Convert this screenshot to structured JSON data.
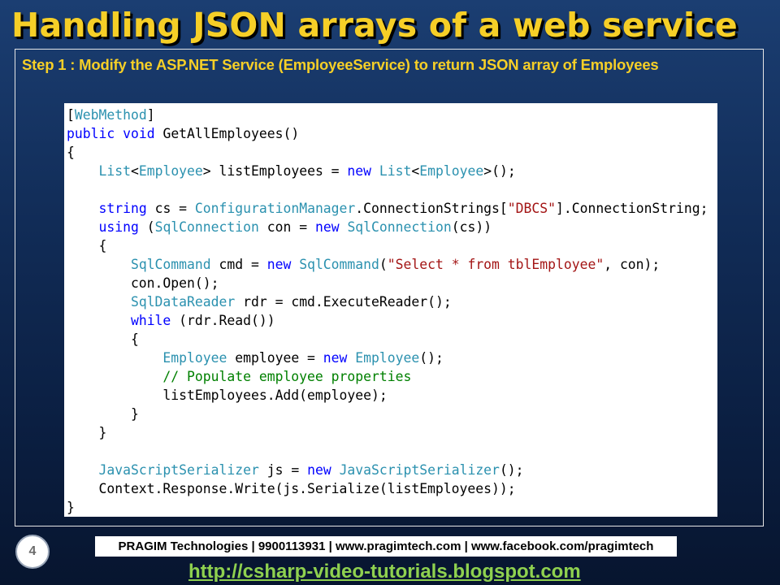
{
  "slide": {
    "title": "Handling JSON arrays of a web service",
    "step_text": "Step 1 : Modify the ASP.NET Service (EmployeeService) to return JSON array of Employees",
    "slide_number": "4",
    "footer_text": "PRAGIM Technologies | 9900113931 | www.pragimtech.com | www.facebook.com/pragimtech",
    "blog_link": "http://csharp-video-tutorials.blogspot.com"
  },
  "colors": {
    "title": "#f6cf27",
    "keyword": "#0000ff",
    "type": "#2b91af",
    "string": "#a31515",
    "comment": "#008000",
    "link": "#8fd14f"
  },
  "code": {
    "language": "csharp",
    "lines": [
      [
        [
          "plain",
          "["
        ],
        [
          "type",
          "WebMethod"
        ],
        [
          "plain",
          "]"
        ]
      ],
      [
        [
          "kw",
          "public"
        ],
        [
          "plain",
          " "
        ],
        [
          "kw",
          "void"
        ],
        [
          "plain",
          " GetAllEmployees()"
        ]
      ],
      [
        [
          "plain",
          "{"
        ]
      ],
      [
        [
          "plain",
          "    "
        ],
        [
          "type",
          "List"
        ],
        [
          "plain",
          "<"
        ],
        [
          "type",
          "Employee"
        ],
        [
          "plain",
          "> listEmployees = "
        ],
        [
          "kw",
          "new"
        ],
        [
          "plain",
          " "
        ],
        [
          "type",
          "List"
        ],
        [
          "plain",
          "<"
        ],
        [
          "type",
          "Employee"
        ],
        [
          "plain",
          ">();"
        ]
      ],
      [],
      [
        [
          "plain",
          "    "
        ],
        [
          "kw",
          "string"
        ],
        [
          "plain",
          " cs = "
        ],
        [
          "type",
          "ConfigurationManager"
        ],
        [
          "plain",
          ".ConnectionStrings["
        ],
        [
          "str",
          "\"DBCS\""
        ],
        [
          "plain",
          "].ConnectionString;"
        ]
      ],
      [
        [
          "plain",
          "    "
        ],
        [
          "kw",
          "using"
        ],
        [
          "plain",
          " ("
        ],
        [
          "type",
          "SqlConnection"
        ],
        [
          "plain",
          " con = "
        ],
        [
          "kw",
          "new"
        ],
        [
          "plain",
          " "
        ],
        [
          "type",
          "SqlConnection"
        ],
        [
          "plain",
          "(cs))"
        ]
      ],
      [
        [
          "plain",
          "    {"
        ]
      ],
      [
        [
          "plain",
          "        "
        ],
        [
          "type",
          "SqlCommand"
        ],
        [
          "plain",
          " cmd = "
        ],
        [
          "kw",
          "new"
        ],
        [
          "plain",
          " "
        ],
        [
          "type",
          "SqlCommand"
        ],
        [
          "plain",
          "("
        ],
        [
          "str",
          "\"Select * from tblEmployee\""
        ],
        [
          "plain",
          ", con);"
        ]
      ],
      [
        [
          "plain",
          "        con.Open();"
        ]
      ],
      [
        [
          "plain",
          "        "
        ],
        [
          "type",
          "SqlDataReader"
        ],
        [
          "plain",
          " rdr = cmd.ExecuteReader();"
        ]
      ],
      [
        [
          "plain",
          "        "
        ],
        [
          "kw",
          "while"
        ],
        [
          "plain",
          " (rdr.Read())"
        ]
      ],
      [
        [
          "plain",
          "        {"
        ]
      ],
      [
        [
          "plain",
          "            "
        ],
        [
          "type",
          "Employee"
        ],
        [
          "plain",
          " employee = "
        ],
        [
          "kw",
          "new"
        ],
        [
          "plain",
          " "
        ],
        [
          "type",
          "Employee"
        ],
        [
          "plain",
          "();"
        ]
      ],
      [
        [
          "plain",
          "            "
        ],
        [
          "cmt",
          "// Populate employee properties"
        ]
      ],
      [
        [
          "plain",
          "            listEmployees.Add(employee);"
        ]
      ],
      [
        [
          "plain",
          "        }"
        ]
      ],
      [
        [
          "plain",
          "    }"
        ]
      ],
      [],
      [
        [
          "plain",
          "    "
        ],
        [
          "type",
          "JavaScriptSerializer"
        ],
        [
          "plain",
          " js = "
        ],
        [
          "kw",
          "new"
        ],
        [
          "plain",
          " "
        ],
        [
          "type",
          "JavaScriptSerializer"
        ],
        [
          "plain",
          "();"
        ]
      ],
      [
        [
          "plain",
          "    Context.Response.Write(js.Serialize(listEmployees));"
        ]
      ],
      [
        [
          "plain",
          "}"
        ]
      ]
    ]
  }
}
